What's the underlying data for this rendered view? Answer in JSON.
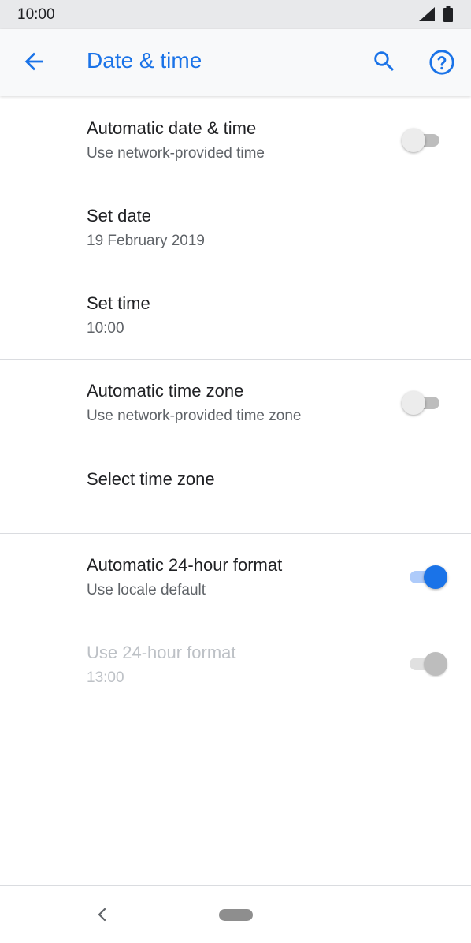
{
  "status_bar": {
    "time": "10:00",
    "icons": [
      "signal-icon",
      "battery-icon"
    ]
  },
  "app_bar": {
    "title": "Date & time",
    "icons": [
      "back-arrow-icon",
      "search-icon",
      "help-icon"
    ]
  },
  "settings": {
    "auto_date_time": {
      "title": "Automatic date & time",
      "subtitle": "Use network-provided time",
      "enabled": false
    },
    "set_date": {
      "title": "Set date",
      "value": "19 February 2019"
    },
    "set_time": {
      "title": "Set time",
      "value": "10:00"
    },
    "auto_time_zone": {
      "title": "Automatic time zone",
      "subtitle": "Use network-provided time zone",
      "enabled": false
    },
    "select_time_zone": {
      "title": "Select time zone"
    },
    "auto_24_hour": {
      "title": "Automatic 24-hour format",
      "subtitle": "Use locale default",
      "enabled": true
    },
    "use_24_hour": {
      "title": "Use 24-hour format",
      "subtitle": "13:00",
      "enabled": true,
      "disabled": true
    }
  },
  "colors": {
    "accent": "#1a73e8",
    "app_bar_background": "#f8f9fa",
    "status_bar_background": "#e8e9eb",
    "text_primary": "#202124",
    "text_secondary": "#5f6368",
    "text_disabled": "#bdc1c6"
  },
  "nav_bar": {
    "icons": [
      "nav-back-icon",
      "home-pill"
    ]
  }
}
